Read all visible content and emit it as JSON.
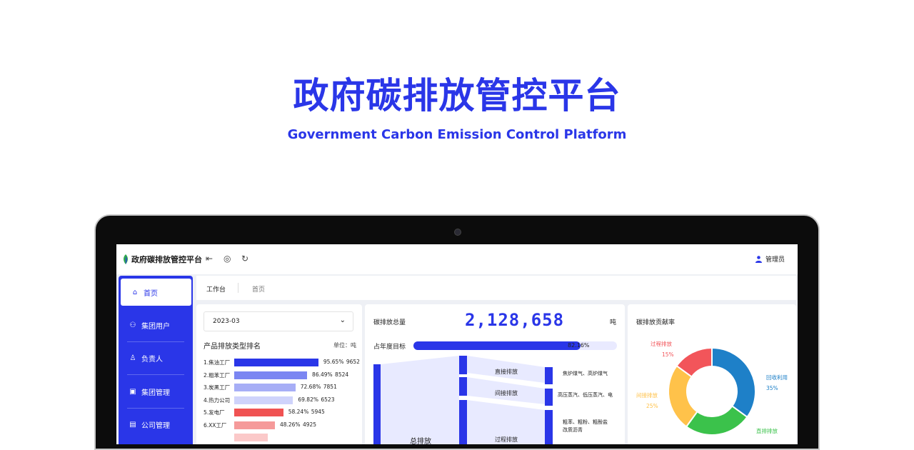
{
  "hero": {
    "title": "政府碳排放管控平台",
    "subtitle": "Government Carbon Emission Control Platform",
    "color": "#2a36e8"
  },
  "app": {
    "logo_text": "政府碳排放管控平台",
    "toolbar_icons": [
      "menu-fold-icon",
      "globe-icon",
      "refresh-icon"
    ],
    "user_label": "管理员"
  },
  "sidebar": {
    "items": [
      {
        "label": "首页",
        "icon": "home-icon",
        "active": true
      },
      {
        "label": "集团用户",
        "icon": "group-users-icon",
        "active": false
      },
      {
        "label": "负责人",
        "icon": "person-icon",
        "active": false
      },
      {
        "label": "集团管理",
        "icon": "monitor-icon",
        "active": false
      },
      {
        "label": "公司管理",
        "icon": "document-icon",
        "active": false
      }
    ]
  },
  "tabs": [
    {
      "label": "工作台",
      "active": true
    },
    {
      "label": "首页",
      "active": false
    }
  ],
  "ranking": {
    "selected_month": "2023-03",
    "title": "产品排放类型排名",
    "unit": "单位：吨",
    "rows": [
      {
        "name": "1.焦油工厂",
        "percent": 95.65,
        "percent_text": "95.65%",
        "value": "9652",
        "color": "#2a36e8"
      },
      {
        "name": "2.粗苯工厂",
        "percent": 86.49,
        "percent_text": "86.49%",
        "value": "8524",
        "color": "#7b86f2"
      },
      {
        "name": "3.炭黑工厂",
        "percent": 72.68,
        "percent_text": "72.68%",
        "value": "7851",
        "color": "#a7aef6"
      },
      {
        "name": "4.热力公司",
        "percent": 69.82,
        "percent_text": "69.82%",
        "value": "6523",
        "color": "#cfd3fb"
      },
      {
        "name": "5.发电厂",
        "percent": 58.24,
        "percent_text": "58.24%",
        "value": "5945",
        "color": "#f05252"
      },
      {
        "name": "6.XX工厂",
        "percent": 48.26,
        "percent_text": "48.26%",
        "value": "4925",
        "color": "#f59a9a"
      },
      {
        "name": "",
        "percent": 40,
        "percent_text": "",
        "value": "",
        "color": "#fbc9c9"
      }
    ]
  },
  "total": {
    "label": "碳排放总量",
    "value": "2,128,658",
    "unit": "吨",
    "target_label": "占年度目标",
    "target_percent": 82.16,
    "target_text": "82.16%"
  },
  "sankey": {
    "source": "总排放",
    "middle": [
      "直接排放",
      "间接排放",
      "过程排放"
    ],
    "targets": [
      "焦炉煤气、高炉煤气",
      "高压蒸汽、低压蒸汽、电",
      "粗苯、粗粉、粗酚盐",
      "改质沥青"
    ]
  },
  "contribution": {
    "title": "碳排放贡献率",
    "segments": [
      {
        "name": "回收利用",
        "percent": 35,
        "percent_text": "35%",
        "color": "#1e80c8"
      },
      {
        "name": "直排排放",
        "percent": 25,
        "percent_text": "",
        "color": "#3bc24b"
      },
      {
        "name": "间接排放",
        "percent": 25,
        "percent_text": "25%",
        "color": "#ffc24a"
      },
      {
        "name": "过程排放",
        "percent": 15,
        "percent_text": "15%",
        "color": "#f2555a"
      }
    ]
  }
}
